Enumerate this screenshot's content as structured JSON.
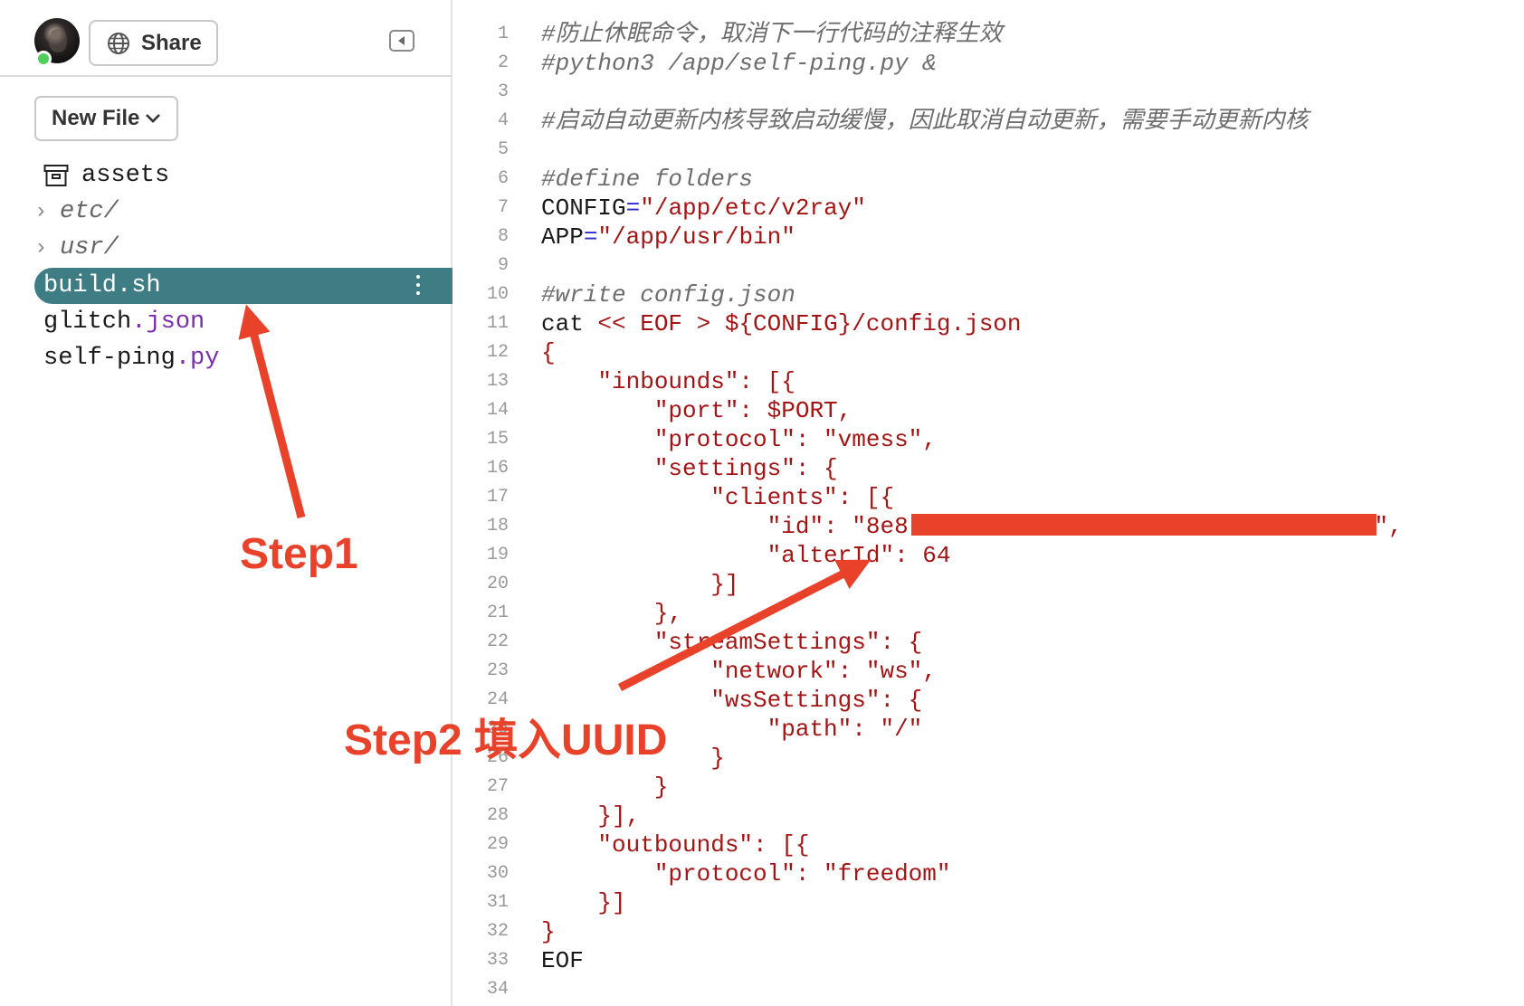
{
  "header": {
    "share_label": "Share",
    "avatar": "user-avatar",
    "status_color": "#4cd05a"
  },
  "sidebar": {
    "new_file_label": "New File",
    "items": [
      {
        "name": "assets",
        "icon": "archive-icon"
      },
      {
        "name": "etc/",
        "icon": "chevron-right-icon"
      },
      {
        "name": "usr/",
        "icon": "chevron-right-icon"
      },
      {
        "base": "build.sh",
        "selected": true
      },
      {
        "base": "glitch",
        "ext": ".json"
      },
      {
        "base": "self-ping",
        "ext": ".py"
      }
    ],
    "selected_color": "#3e7d83"
  },
  "editor": {
    "lines": [
      {
        "no": "1",
        "text": "#防止休眠命令，取消下一行代码的注释生效",
        "kind": "comment"
      },
      {
        "no": "2",
        "text": "#python3 /app/self-ping.py &",
        "kind": "comment"
      },
      {
        "no": "3",
        "text": "",
        "kind": "plain"
      },
      {
        "no": "4",
        "text": "#启动自动更新内核导致启动缓慢，因此取消自动更新，需要手动更新内核",
        "kind": "comment"
      },
      {
        "no": "5",
        "text": "",
        "kind": "plain"
      },
      {
        "no": "6",
        "text": "#define folders",
        "kind": "comment"
      },
      {
        "no": "7",
        "text": "CONFIG=\"/app/etc/v2ray\"",
        "kind": "assign",
        "var": "CONFIG",
        "value": "\"/app/etc/v2ray\""
      },
      {
        "no": "8",
        "text": "APP=\"/app/usr/bin\"",
        "kind": "assign",
        "var": "APP",
        "value": "\"/app/usr/bin\""
      },
      {
        "no": "9",
        "text": "",
        "kind": "plain"
      },
      {
        "no": "10",
        "text": "#write config.json",
        "kind": "comment"
      },
      {
        "no": "11",
        "text": "cat << EOF > ${CONFIG}/config.json",
        "kind": "cat"
      },
      {
        "no": "12",
        "text": "{",
        "kind": "string"
      },
      {
        "no": "13",
        "text": "    \"inbounds\": [{",
        "kind": "string"
      },
      {
        "no": "14",
        "text": "        \"port\": $PORT,",
        "kind": "string"
      },
      {
        "no": "15",
        "text": "        \"protocol\": \"vmess\",",
        "kind": "string"
      },
      {
        "no": "16",
        "text": "        \"settings\": {",
        "kind": "string"
      },
      {
        "no": "17",
        "text": "            \"clients\": [{",
        "kind": "string"
      },
      {
        "no": "18",
        "text": "                \"id\": \"8e8                                 \",",
        "kind": "string"
      },
      {
        "no": "19",
        "text": "                \"alterId\": 64",
        "kind": "string"
      },
      {
        "no": "20",
        "text": "            }]",
        "kind": "string"
      },
      {
        "no": "21",
        "text": "        },",
        "kind": "string"
      },
      {
        "no": "22",
        "text": "        \"streamSettings\": {",
        "kind": "string"
      },
      {
        "no": "23",
        "text": "            \"network\": \"ws\",",
        "kind": "string"
      },
      {
        "no": "24",
        "text": "            \"wsSettings\": {",
        "kind": "string"
      },
      {
        "no": "25",
        "text": "                \"path\": \"/\"",
        "kind": "string"
      },
      {
        "no": "26",
        "text": "            }",
        "kind": "string"
      },
      {
        "no": "27",
        "text": "        }",
        "kind": "string"
      },
      {
        "no": "28",
        "text": "    }],",
        "kind": "string"
      },
      {
        "no": "29",
        "text": "    \"outbounds\": [{",
        "kind": "string"
      },
      {
        "no": "30",
        "text": "        \"protocol\": \"freedom\"",
        "kind": "string"
      },
      {
        "no": "31",
        "text": "    }]",
        "kind": "string"
      },
      {
        "no": "32",
        "text": "}",
        "kind": "string"
      },
      {
        "no": "33",
        "text": "EOF",
        "kind": "string"
      },
      {
        "no": "34",
        "text": "",
        "kind": "plain"
      }
    ]
  },
  "annotations": {
    "step1": "Step1",
    "step2": "Step2 填入UUID",
    "color": "#e8422b"
  }
}
